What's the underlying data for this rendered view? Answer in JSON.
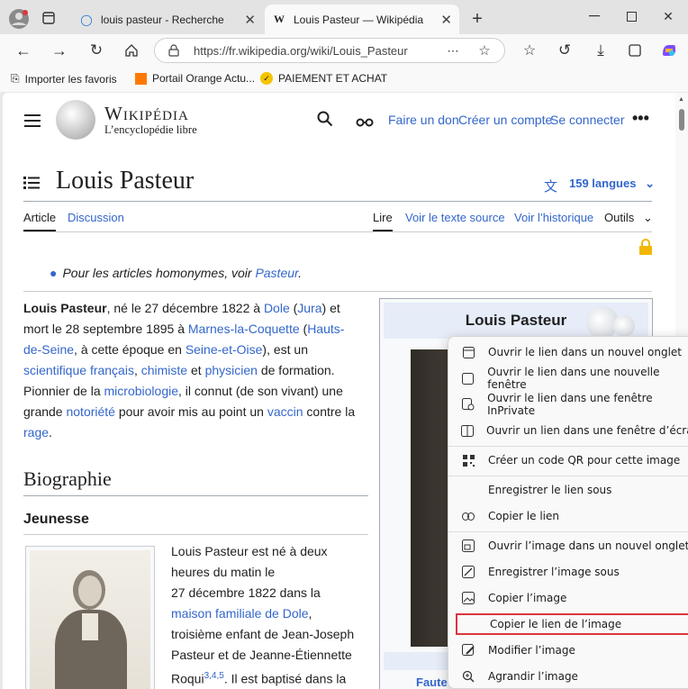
{
  "tabs": [
    {
      "title": "louis pasteur - Recherche",
      "icon": "edge-search-icon"
    },
    {
      "title": "Louis Pasteur — Wikipédia",
      "icon": "wikipedia-w-icon"
    }
  ],
  "address": {
    "url": "https://fr.wikipedia.org/wiki/Louis_Pasteur"
  },
  "favorites": [
    {
      "label": "Importer les favoris"
    },
    {
      "label": "Portail Orange   Actu..."
    },
    {
      "label": "PAIEMENT ET ACHAT"
    }
  ],
  "wiki": {
    "logo_title": "Wikipédia",
    "logo_sub": "L’encyclopédie libre",
    "header_links": [
      "Faire un don",
      "Créer un compte",
      "Se connecter"
    ],
    "page_title": "Louis Pasteur",
    "languages": "159 langues",
    "tabs_left": [
      "Article",
      "Discussion"
    ],
    "tabs_right": [
      "Lire",
      "Voir le texte source",
      "Voir l’historique",
      "Outils"
    ],
    "hatnote_text": "Pour les articles homonymes, voir ",
    "hatnote_link": "Pasteur",
    "hatnote_end": ".",
    "intro": {
      "l1a": "Louis Pasteur",
      "l1b": ", né le 27 décembre 1822 à ",
      "l1c": "Dole",
      "l1d": " (",
      "l1e": "Jura",
      "l1f": ") et",
      "l2a": "mort le 28 septembre 1895 à ",
      "l2b": "Marnes-la-Coquette",
      "l2c": " (",
      "l2d": "Hauts-",
      "l3a": "de-Seine",
      "l3b": ", à cette époque en ",
      "l3c": "Seine-et-Oise",
      "l3d": "), est un",
      "l4a": "scientifique",
      "l4b": " ",
      "l4c": "français",
      "l4d": ", ",
      "l4e": "chimiste",
      "l4f": " et ",
      "l4g": "physicien",
      "l4h": " de formation.",
      "l5a": "Pionnier de la ",
      "l5b": "microbiologie",
      "l5c": ", il connut (de son vivant) une",
      "l6a": "grande ",
      "l6b": "notoriété",
      "l6c": " pour avoir mis au point un ",
      "l6d": "vaccin",
      "l6e": " contre la",
      "l7a": "rage",
      "l7b": "."
    },
    "section_title": "Biographie",
    "subsection_title": "Jeunesse",
    "bio": {
      "b1": "Louis Pasteur est né à deux",
      "b2": "heures du matin le",
      "b3": "27 décembre 1822 dans la",
      "b4": "maison familiale de Dole",
      "b4e": ",",
      "b5": "troisième enfant de Jean-Joseph",
      "b6": "Pasteur et de Jeanne-Étiennette",
      "b7a": "Roqui",
      "b7refs": "3,4,5",
      "b7b": ". Il est baptisé dans la"
    },
    "infobox_title": "Louis Pasteur",
    "infobox_partial": "Faute"
  },
  "context_menu": [
    {
      "label": "Ouvrir le lien dans un nouvel onglet",
      "icon": "new-tab-icon"
    },
    {
      "label": "Ouvrir le lien dans une nouvelle fenêtre",
      "icon": "new-window-icon"
    },
    {
      "label": "Ouvrir le lien dans une fenêtre InPrivate",
      "icon": "inprivate-icon"
    },
    {
      "label": "Ouvrir un lien dans une fenêtre d’écran fr",
      "icon": "split-screen-icon"
    },
    {
      "label": "Créer un code QR pour cette image",
      "icon": "qr-code-icon"
    },
    {
      "label": "Enregistrer le lien sous",
      "icon": ""
    },
    {
      "label": "Copier le lien",
      "icon": "link-icon"
    },
    {
      "label": "Ouvrir l’image dans un nouvel onglet",
      "icon": "image-new-tab-icon"
    },
    {
      "label": "Enregistrer l’image sous",
      "icon": "save-image-icon"
    },
    {
      "label": "Copier l’image",
      "icon": "copy-image-icon"
    },
    {
      "label": "Copier le lien de l’image",
      "icon": "",
      "highlighted": true
    },
    {
      "label": "Modifier l’image",
      "icon": "edit-image-icon"
    },
    {
      "label": "Agrandir l’image",
      "icon": "zoom-image-icon"
    }
  ],
  "colors": {
    "link": "#3366cc",
    "highlight_border": "#d9363e",
    "lock": "#f2b705"
  }
}
